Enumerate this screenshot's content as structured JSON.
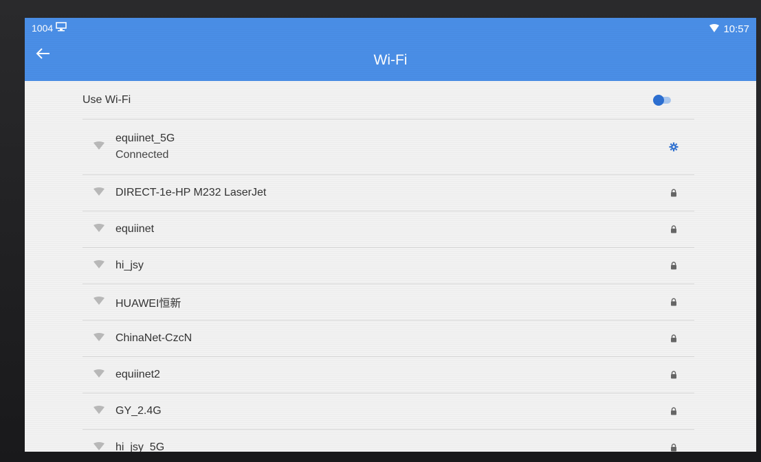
{
  "status_bar": {
    "left_text": "1004",
    "left_icon": "monitor-icon",
    "right_icon": "wifi-signal-icon",
    "time": "10:57"
  },
  "app_bar": {
    "back_icon": "arrow-back-icon",
    "title": "Wi-Fi",
    "color": "#4a8ee6"
  },
  "toggle": {
    "label": "Use Wi-Fi",
    "state": "on",
    "accent": "#2c6fd1"
  },
  "networks": [
    {
      "name": "equiinet_5G",
      "status": "Connected",
      "end_icon": "gear-icon"
    },
    {
      "name": "DIRECT-1e-HP M232 LaserJet",
      "end_icon": "lock-icon"
    },
    {
      "name": "equiinet",
      "end_icon": "lock-icon"
    },
    {
      "name": "hi_jsy",
      "end_icon": "lock-icon"
    },
    {
      "name": "HUAWEI恒新",
      "end_icon": "lock-icon"
    },
    {
      "name": "ChinaNet-CzcN",
      "end_icon": "lock-icon"
    },
    {
      "name": "equiinet2",
      "end_icon": "lock-icon"
    },
    {
      "name": "GY_2.4G",
      "end_icon": "lock-icon"
    },
    {
      "name": "hi_jsy_5G",
      "end_icon": "lock-icon"
    }
  ]
}
